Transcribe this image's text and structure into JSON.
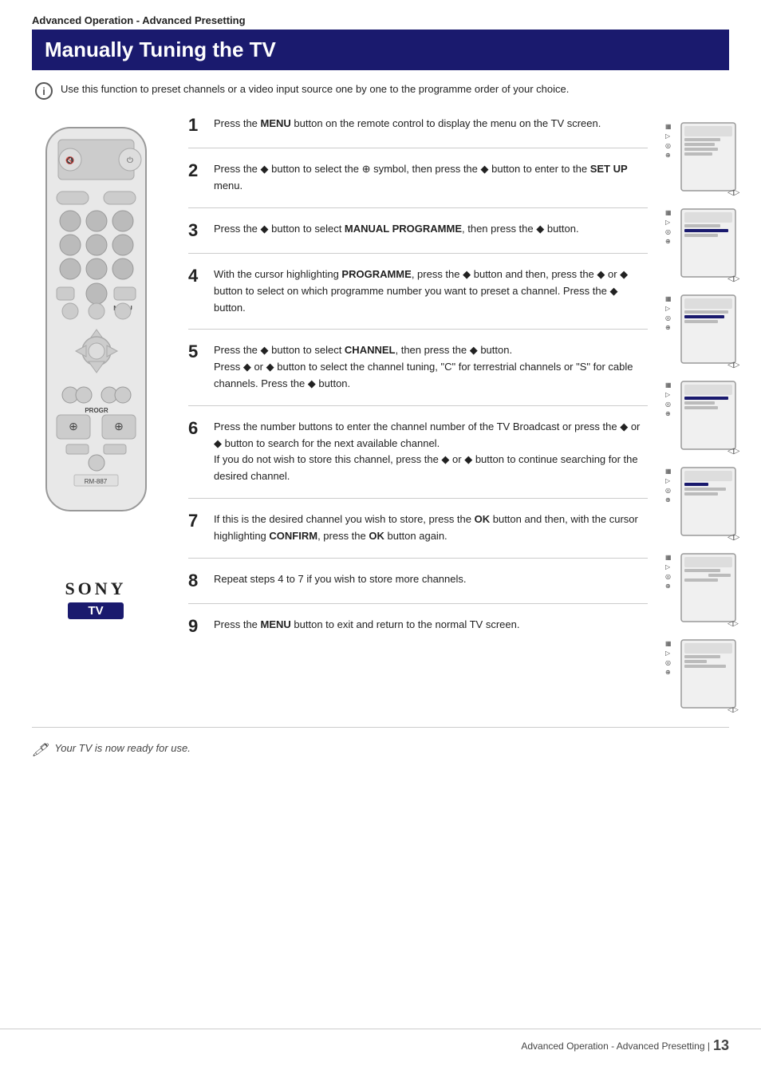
{
  "header": {
    "section_label": "Advanced Operation - Advanced Presetting",
    "page_title": "Manually Tuning the TV"
  },
  "info": {
    "text": "Use this function to preset channels or a video input source one by one to the programme order of your choice."
  },
  "steps": [
    {
      "number": "1",
      "text": "Press the MENU button on the remote control to display the menu on the TV screen."
    },
    {
      "number": "2",
      "text": "Press the ◆ button to select the ⊕ symbol, then press the ◆ button to enter to the SET UP menu."
    },
    {
      "number": "3",
      "text": "Press the ◆ button to select MANUAL PROGRAMME, then press the ◆ button."
    },
    {
      "number": "4",
      "text": "With the cursor highlighting PROGRAMME, press the ◆ button and then, press the ◆ or ◆ button to select on which programme number you want to preset a channel. Press the ◆ button."
    },
    {
      "number": "5",
      "text": "Press the ◆ button to select CHANNEL, then press the ◆ button. Press ◆ or ◆ button to select the channel tuning, \"C\" for terrestrial channels or \"S\" for cable channels. Press the ◆ button."
    },
    {
      "number": "6",
      "text": "Press the number buttons to enter the channel number of the TV Broadcast or press the ◆ or ◆ button to search for the next available channel.\nIf you do not wish to store this channel, press the ◆ or ◆ button to continue searching for the desired channel."
    },
    {
      "number": "7",
      "text": "If this is the desired channel you wish to store, press the OK button and then, with the cursor highlighting CONFIRM, press the OK button again."
    },
    {
      "number": "8",
      "text": "Repeat steps 4 to 7 if you wish to store more channels."
    },
    {
      "number": "9",
      "text": "Press the MENU button to exit and return to the normal TV screen."
    }
  ],
  "footer_note": "Your TV is now ready for use.",
  "page_footer": {
    "label": "Advanced Operation - Advanced Presetting |",
    "page_number": "13"
  },
  "remote": {
    "model": "RM-887",
    "brand": "SONY",
    "badge": "TV"
  }
}
